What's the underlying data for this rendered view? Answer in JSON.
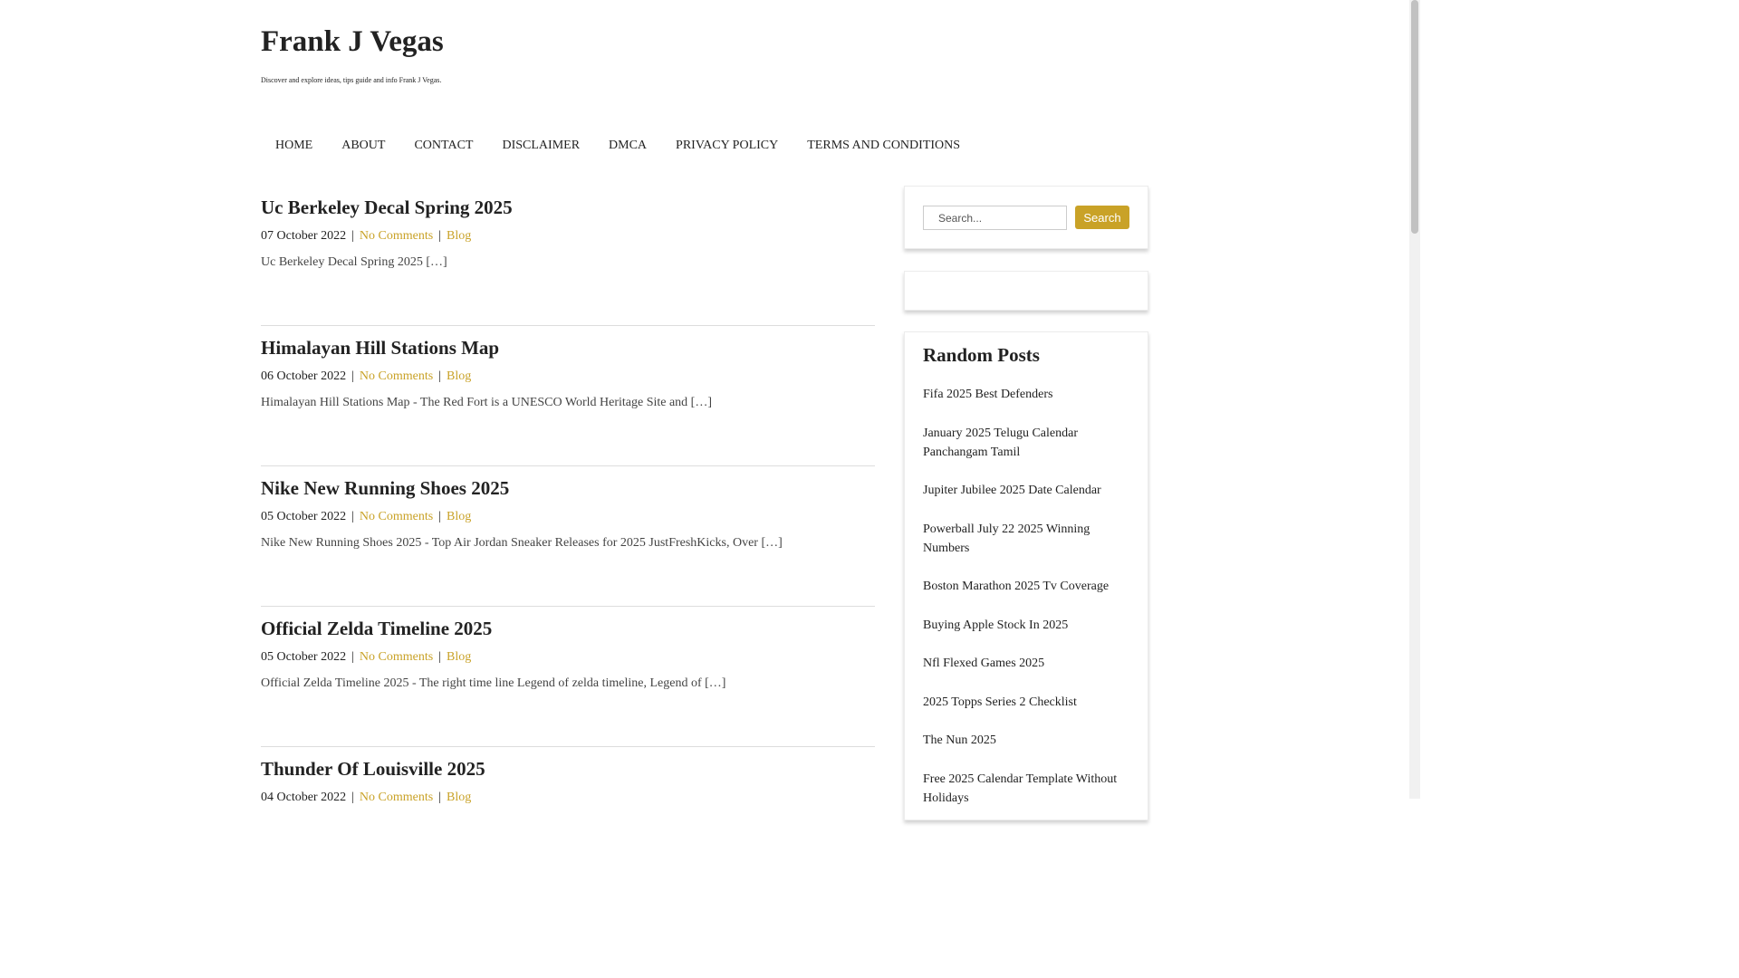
{
  "header": {
    "site_title": "Frank J Vegas",
    "site_description": "Discover and explore ideas, tips guide and info Frank J Vegas."
  },
  "nav": {
    "items": [
      "HOME",
      "ABOUT",
      "CONTACT",
      "DISCLAIMER",
      "DMCA",
      "PRIVACY POLICY",
      "TERMS AND CONDITIONS"
    ]
  },
  "posts": [
    {
      "title": "Uc Berkeley Decal Spring 2025",
      "date": "07 October 2022",
      "comments": "No Comments",
      "category": "Blog",
      "excerpt": "Uc Berkeley Decal Spring 2025 […]"
    },
    {
      "title": "Himalayan Hill Stations Map",
      "date": "06 October 2022",
      "comments": "No Comments",
      "category": "Blog",
      "excerpt": "Himalayan Hill Stations Map - The Red Fort is a UNESCO World Heritage Site and […]"
    },
    {
      "title": "Nike New Running Shoes 2025",
      "date": "05 October 2022",
      "comments": "No Comments",
      "category": "Blog",
      "excerpt": "Nike New Running Shoes 2025 - Top Air Jordan Sneaker Releases for 2025 JustFreshKicks, Over […]"
    },
    {
      "title": "Official Zelda Timeline 2025",
      "date": "05 October 2022",
      "comments": "No Comments",
      "category": "Blog",
      "excerpt": "Official Zelda Timeline 2025 - The right time line Legend of zelda timeline, Legend of […]"
    },
    {
      "title": "Thunder Of Louisville 2025",
      "date": "04 October 2022",
      "comments": "No Comments",
      "category": "Blog",
      "excerpt": ""
    }
  ],
  "sidebar": {
    "search": {
      "placeholder": "Search...",
      "button_label": "Search"
    },
    "random_posts": {
      "heading": "Random Posts",
      "items": [
        "Fifa 2025 Best Defenders",
        "January 2025 Telugu Calendar Panchangam Tamil",
        "Jupiter Jubilee 2025 Date Calendar",
        "Powerball July 22 2025 Winning Numbers",
        "Boston Marathon 2025 Tv Coverage",
        "Buying Apple Stock In 2025",
        "Nfl Flexed Games 2025",
        "2025 Topps Series 2 Checklist",
        "The Nun 2025",
        "Free 2025 Calendar Template Without Holidays"
      ]
    }
  },
  "colors": {
    "accent": "#c9a227",
    "text": "#222222",
    "border": "#dddddd"
  }
}
